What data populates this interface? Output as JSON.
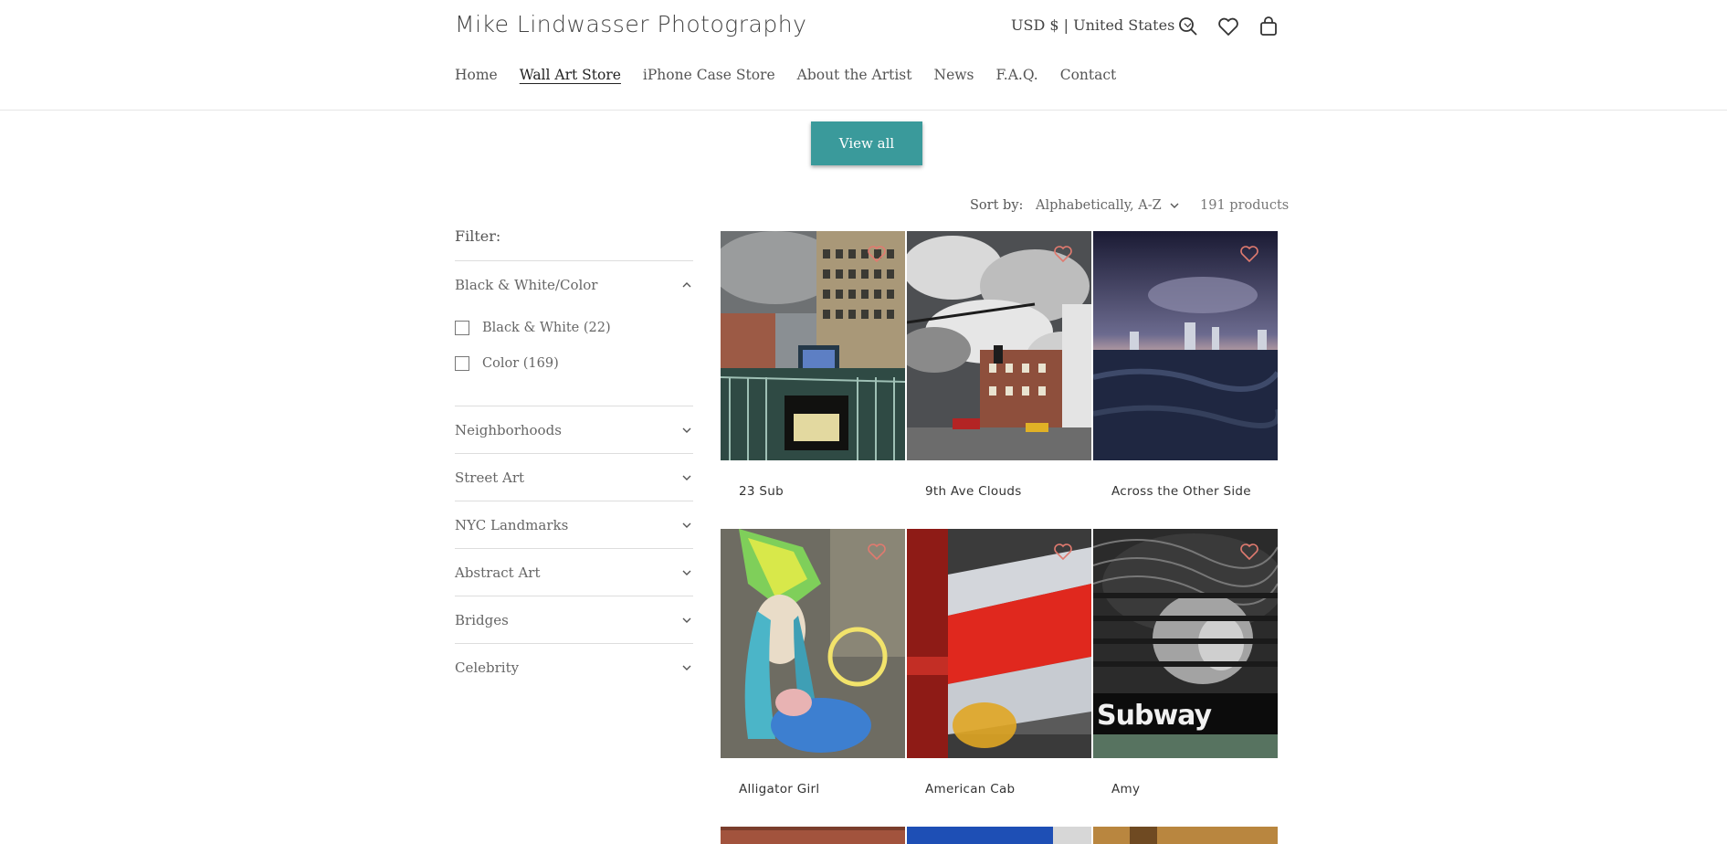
{
  "header": {
    "brand": "Mike Lindwasser Photography",
    "currency": "USD $ | United States",
    "nav": [
      "Home",
      "Wall Art Store",
      "iPhone Case Store",
      "About the Artist",
      "News",
      "F.A.Q.",
      "Contact"
    ],
    "active_nav": "Wall Art Store",
    "icons": [
      "search-icon",
      "heart-icon",
      "cart-icon"
    ]
  },
  "collection": {
    "view_all_label": "View all",
    "sort_label": "Sort by:",
    "sort_value": "Alphabetically, A-Z",
    "product_count": "191 products"
  },
  "filter": {
    "title": "Filter:",
    "open_facet": "Black & White/Color",
    "options": [
      "Black & White (22)",
      "Color (169)"
    ],
    "facets": [
      "Neighborhoods",
      "Street Art",
      "NYC Landmarks",
      "Abstract Art",
      "Bridges",
      "Celebrity"
    ]
  },
  "products": [
    {
      "title": "23 Sub"
    },
    {
      "title": "9th Ave Clouds"
    },
    {
      "title": "Across the Other Side"
    },
    {
      "title": "Alligator Girl"
    },
    {
      "title": "American Cab"
    },
    {
      "title": "Amy"
    }
  ],
  "overlay_text": {
    "amy_sign": "Subway"
  },
  "colors": {
    "accent": "#3a9a9b",
    "heart": "#e07a6f"
  }
}
